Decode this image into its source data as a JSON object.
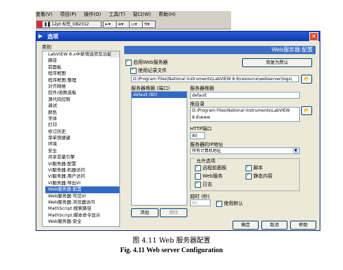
{
  "menubar": [
    "查看(V)",
    "项目(P)",
    "操作(O)",
    "工具(T)",
    "窗口(W)",
    "帮助(H)"
  ],
  "toolbar": {
    "font_select": "12pt 标签_GB2312"
  },
  "dialog": {
    "title": "选项",
    "category_label": "类别",
    "categories": [
      "LabVIEW 8.x中新增选项及功能",
      "路径",
      "前面板",
      "程序框图",
      "程序框图:整理",
      "对齐网格",
      "控件/函数选板",
      "源代码控制",
      "调试",
      "颜色",
      "字体",
      "打印",
      "修订历史",
      "菜单快捷键",
      "环境",
      "安全",
      "共享变量引擎",
      "VI服务器:配置",
      "VI服务器:机器访问",
      "VI服务器:用户访问",
      "VI服务器:导出VI",
      "Web服务器:配置",
      "Web服务器:可见VI",
      "Web服务器:浏览器访问",
      "MathScript:搜索路径",
      "MathScript:脚本命令显示",
      "Web服务器:安全"
    ],
    "selected_category": "Web服务器:配置",
    "panel_title": "Web服务器:配置",
    "enable_server": "启用Web服务器",
    "restore_default": "恢复为默认",
    "use_log": "使用记录文件",
    "log_path": "D:\\Program Files\\National Instruments\\LabVIEW 8.6\\resource\\webserver\\logs\\",
    "server_list_label": "服务器根据 (端口)",
    "server_list_item": "default  (80)",
    "server_root_label": "服务器根据",
    "server_root_value": "default",
    "root_dir_label": "根目录",
    "root_dir_value": "D:\\Program Files\\National Instruments\\LabVIEW 8.6\\www",
    "http_port_label": "HTTP端口",
    "http_port_value": "80",
    "bind_label": "服务器的IP地址",
    "bind_value": "所有计算机地址",
    "allow_group": "允许选项",
    "opt_remote_panel": "远程前面板",
    "opt_script": "脚本",
    "opt_web_server": "Web服务",
    "opt_browse": "静态内容",
    "opt_log": "日志",
    "timeout_label": "超时 (秒)",
    "timeout_value": "60",
    "use_default": "使用默认",
    "add_btn": "添加",
    "remove_btn": "删除",
    "ok_btn": "确定",
    "cancel_btn": "取消",
    "help_btn": "帮助"
  },
  "caption": {
    "cn": "图 4.11  Web 服务器配置",
    "en": "Fig. 4.11    Web server Configuration"
  }
}
